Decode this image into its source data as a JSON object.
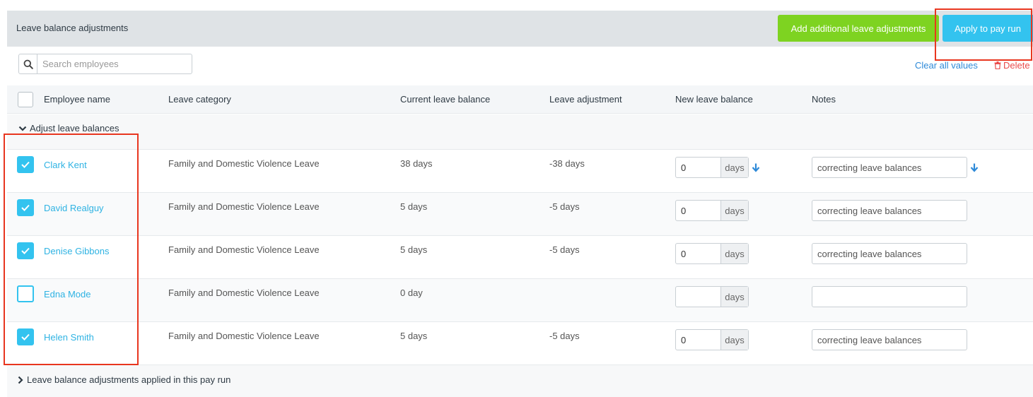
{
  "header": {
    "title": "Leave balance adjustments",
    "add_button": "Add additional leave adjustments",
    "apply_button": "Apply to pay run"
  },
  "search": {
    "placeholder": "Search employees",
    "value": ""
  },
  "actions": {
    "clear": "Clear all values",
    "delete": "Delete"
  },
  "columns": {
    "employee": "Employee name",
    "category": "Leave category",
    "current": "Current leave balance",
    "adjustment": "Leave adjustment",
    "new_balance": "New leave balance",
    "notes": "Notes"
  },
  "group": {
    "label": "Adjust leave balances"
  },
  "rows": [
    {
      "checked": true,
      "name": "Clark Kent",
      "category": "Family and Domestic Violence Leave",
      "current": "38 days",
      "adjustment": "-38 days",
      "new_value": "0",
      "unit": "days",
      "notes": "correcting leave balances"
    },
    {
      "checked": true,
      "name": "David Realguy",
      "category": "Family and Domestic Violence Leave",
      "current": "5 days",
      "adjustment": "-5 days",
      "new_value": "0",
      "unit": "days",
      "notes": "correcting leave balances"
    },
    {
      "checked": true,
      "name": "Denise Gibbons",
      "category": "Family and Domestic Violence Leave",
      "current": "5 days",
      "adjustment": "-5 days",
      "new_value": "0",
      "unit": "days",
      "notes": "correcting leave balances"
    },
    {
      "checked": false,
      "name": "Edna Mode",
      "category": "Family and Domestic Violence Leave",
      "current": "0 day",
      "adjustment": "",
      "new_value": "",
      "unit": "days",
      "notes": ""
    },
    {
      "checked": true,
      "name": "Helen Smith",
      "category": "Family and Domestic Violence Leave",
      "current": "5 days",
      "adjustment": "-5 days",
      "new_value": "0",
      "unit": "days",
      "notes": "correcting leave balances"
    }
  ],
  "footer": {
    "label": "Leave balance adjustments applied in this pay run"
  },
  "colors": {
    "green_button": "#7ed321",
    "blue_button": "#33c3ef",
    "link": "#2e8ad8",
    "delete": "#e94b4b",
    "highlight": "#e8361f"
  },
  "icons": {
    "search": "search-icon",
    "delete": "trash-icon",
    "fill_down": "arrow-down-icon",
    "chevron_down": "chevron-down-icon",
    "chevron_right": "chevron-right-icon",
    "check": "check-icon"
  }
}
